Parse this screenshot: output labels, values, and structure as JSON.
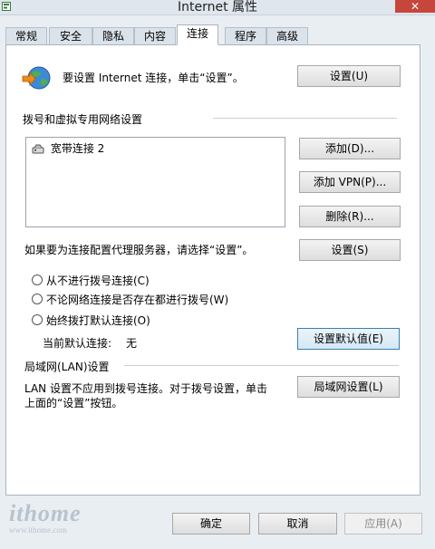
{
  "window": {
    "title": "Internet 属性"
  },
  "tabs": [
    "常规",
    "安全",
    "隐私",
    "内容",
    "连接",
    "程序",
    "高级"
  ],
  "active_tab": "连接",
  "setup": {
    "text": "要设置 Internet 连接，单击“设置”。",
    "button": "设置(U)"
  },
  "dialup_section": {
    "heading": "拨号和虚拟专用网络设置",
    "items": [
      "宽带连接 2"
    ],
    "add_button": "添加(D)...",
    "add_vpn_button": "添加 VPN(P)...",
    "remove_button": "删除(R)...",
    "proxy_text": "如果要为连接配置代理服务器，请选择“设置”。",
    "settings_button": "设置(S)",
    "radios": [
      "从不进行拨号连接(C)",
      "不论网络连接是否存在都进行拨号(W)",
      "始终拨打默认连接(O)"
    ],
    "default_label": "当前默认连接:",
    "default_value": "无",
    "set_default_button": "设置默认值(E)"
  },
  "lan_section": {
    "heading": "局域网(LAN)设置",
    "text_line1": "LAN 设置不应用到拨号连接。对于拨号设置，单击",
    "text_line2": "上面的“设置”按钮。",
    "button": "局域网设置(L)"
  },
  "bottom": {
    "ok": "确定",
    "cancel": "取消",
    "apply": "应用(A)"
  },
  "watermark": {
    "brand": "ithome",
    "url": "www.ithome.com"
  }
}
